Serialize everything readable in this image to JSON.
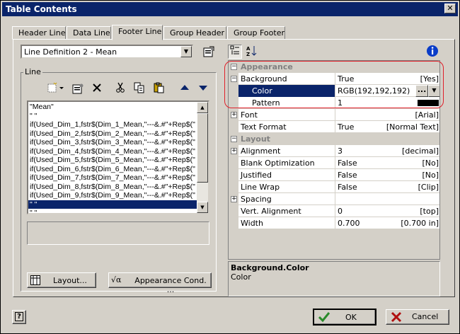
{
  "window": {
    "title": "Table Contents",
    "close_glyph": "✕"
  },
  "tabs": [
    {
      "label": "Header Line"
    },
    {
      "label": "Data Line"
    },
    {
      "label": "Footer Line"
    },
    {
      "label": "Group Header"
    },
    {
      "label": "Group Footer"
    }
  ],
  "active_tab": "Footer Line",
  "line_definition": {
    "value": "Line Definition  2 - Mean"
  },
  "line_group": {
    "label": "Line",
    "lines": [
      "\"Mean\"",
      "\" \"",
      "if(Used_Dim_1,fstr$(Dim_1_Mean,\"---&.#\"+Rep$(\"",
      "if(Used_Dim_2,fstr$(Dim_2_Mean,\"---&.#\"+Rep$(\"",
      "if(Used_Dim_3,fstr$(Dim_3_Mean,\"---&.#\"+Rep$(\"",
      "if(Used_Dim_4,fstr$(Dim_4_Mean,\"---&.#\"+Rep$(\"",
      "if(Used_Dim_5,fstr$(Dim_5_Mean,\"---&.#\"+Rep$(\"",
      "if(Used_Dim_6,fstr$(Dim_6_Mean,\"---&.#\"+Rep$(\"",
      "if(Used_Dim_7,fstr$(Dim_7_Mean,\"---&.#\"+Rep$(\"",
      "if(Used_Dim_8,fstr$(Dim_8_Mean,\"---&.#\"+Rep$(\"",
      "if(Used_Dim_9,fstr$(Dim_9_Mean,\"---&.#\"+Rep$(\"",
      "\" \"",
      "\" \""
    ],
    "selected_index": 11
  },
  "buttons": {
    "layout": "Layout...",
    "appearance_cond": "Appearance Cond. ...",
    "ok": "OK",
    "cancel": "Cancel",
    "help": "?"
  },
  "properties": {
    "categories": {
      "appearance": "Appearance",
      "layout": "Layout"
    },
    "rows": {
      "background": {
        "name": "Background",
        "value": "True",
        "extra": "[Yes]"
      },
      "color": {
        "name": "Color",
        "value": "RGB(192,192,192)",
        "dots": "..."
      },
      "pattern": {
        "name": "Pattern",
        "value": "1"
      },
      "font": {
        "name": "Font",
        "value": "",
        "extra": "[Arial]"
      },
      "text_format": {
        "name": "Text Format",
        "value": "True",
        "extra": "[Normal Text]"
      },
      "alignment": {
        "name": "Alignment",
        "value": "3",
        "extra": "[decimal]"
      },
      "blank_opt": {
        "name": "Blank Optimization",
        "value": "False",
        "extra": "[No]"
      },
      "justified": {
        "name": "Justified",
        "value": "False",
        "extra": "[No]"
      },
      "line_wrap": {
        "name": "Line Wrap",
        "value": "False",
        "extra": "[Clip]"
      },
      "spacing": {
        "name": "Spacing",
        "value": "",
        "extra": ""
      },
      "vert_align": {
        "name": "Vert. Alignment",
        "value": "0",
        "extra": "[top]"
      },
      "width": {
        "name": "Width",
        "value": "0.700",
        "extra": "[0.700 in]"
      }
    },
    "expander_minus": "−",
    "expander_plus": "+"
  },
  "description": {
    "title": "Background.Color",
    "text": "Color"
  },
  "colors": {
    "titlebar": "#0a246a",
    "selection": "#0a246a",
    "highlight_box": "#e0202a",
    "pattern_swatch": "#000000"
  },
  "icons": [
    "properties-icon",
    "new-line-icon",
    "delete-icon",
    "cut-icon",
    "copy-icon",
    "paste-icon",
    "arrow-up-icon",
    "arrow-down-icon",
    "categorized-icon",
    "sort-az-icon",
    "info-icon",
    "help-icon",
    "layout-icon",
    "formula-icon",
    "ok-check-icon",
    "cancel-x-icon"
  ]
}
